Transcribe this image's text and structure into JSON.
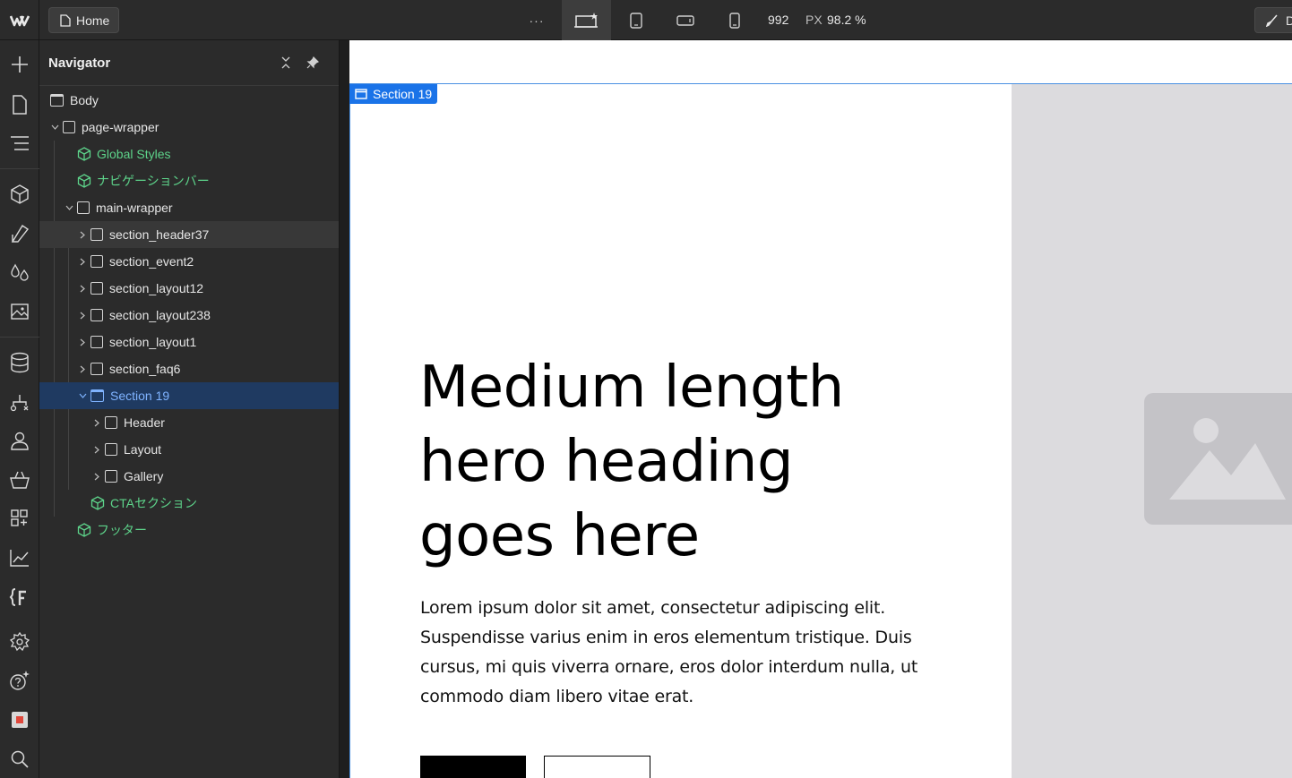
{
  "topbar": {
    "home_label": "Home",
    "more_label": "···",
    "width_value": "992",
    "unit": "PX",
    "zoom": "98.2 %",
    "right_label": "D"
  },
  "navigator": {
    "title": "Navigator",
    "items": [
      {
        "label": "Body"
      },
      {
        "label": "page-wrapper"
      },
      {
        "label": "Global Styles"
      },
      {
        "label": "ナビゲーションバー"
      },
      {
        "label": "main-wrapper"
      },
      {
        "label": "section_header37"
      },
      {
        "label": "section_event2"
      },
      {
        "label": "section_layout12"
      },
      {
        "label": "section_layout238"
      },
      {
        "label": "section_layout1"
      },
      {
        "label": "section_faq6"
      },
      {
        "label": "Section 19"
      },
      {
        "label": "Header"
      },
      {
        "label": "Layout"
      },
      {
        "label": "Gallery"
      },
      {
        "label": "CTAセクション"
      },
      {
        "label": "フッター"
      }
    ]
  },
  "canvas": {
    "selection_label": "Section 19",
    "hero_heading": "Medium length hero heading goes here",
    "hero_paragraph": "Lorem ipsum dolor sit amet, consectetur adipiscing elit. Suspendisse varius enim in eros elementum tristique. Duis cursus, mi quis viverra ornare, eros dolor interdum nulla, ut commodo diam libero vitae erat."
  },
  "colors": {
    "selection_blue": "#1a73e8",
    "component_green": "#5dd38a",
    "selected_row_bg": "#1f3a61"
  }
}
